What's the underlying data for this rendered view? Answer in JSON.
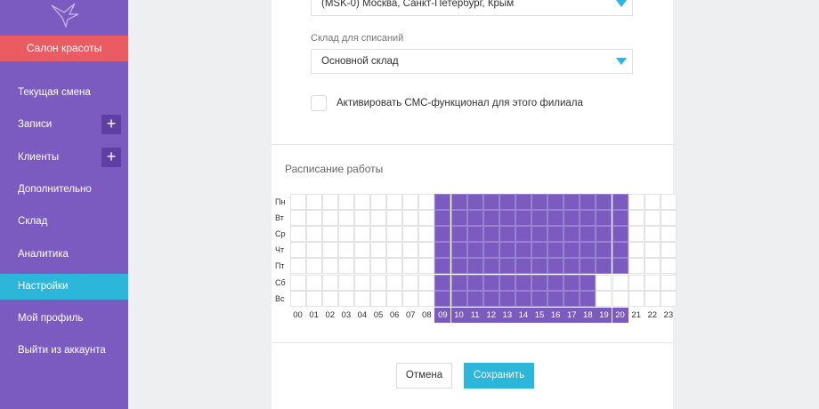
{
  "sidebar": {
    "salon_label": "Салон красоты",
    "items": [
      {
        "label": "Текущая смена",
        "active": false,
        "has_add": false
      },
      {
        "label": "Записи",
        "active": false,
        "has_add": true
      },
      {
        "label": "Клиенты",
        "active": false,
        "has_add": true
      },
      {
        "label": "Дополнительно",
        "active": false,
        "has_add": false
      },
      {
        "label": "Склад",
        "active": false,
        "has_add": false
      },
      {
        "label": "Аналитика",
        "active": false,
        "has_add": false
      },
      {
        "label": "Настройки",
        "active": true,
        "has_add": false
      },
      {
        "label": "Мой профиль",
        "active": false,
        "has_add": false
      },
      {
        "label": "Выйти из аккаунта",
        "active": false,
        "has_add": false
      }
    ],
    "add_symbol": "+"
  },
  "form": {
    "timezone_value": "(MSK-0) Москва, Санкт-Петербург, Крым",
    "warehouse_label": "Склад для списаний",
    "warehouse_value": "Основной склад",
    "sms_checkbox_label": "Активировать СМС-функционал для этого филиала",
    "sms_checked": false
  },
  "schedule": {
    "title": "Расписание работы",
    "days": [
      "Пн",
      "Вт",
      "Ср",
      "Чт",
      "Пт",
      "Сб",
      "Вс"
    ],
    "hours": [
      "00",
      "01",
      "02",
      "03",
      "04",
      "05",
      "06",
      "07",
      "08",
      "09",
      "10",
      "11",
      "12",
      "13",
      "14",
      "15",
      "16",
      "17",
      "18",
      "19",
      "20",
      "21",
      "22",
      "23"
    ],
    "active_hours": [
      [
        9,
        10,
        11,
        12,
        13,
        14,
        15,
        16,
        17,
        18,
        19,
        20
      ],
      [
        9,
        10,
        11,
        12,
        13,
        14,
        15,
        16,
        17,
        18,
        19,
        20
      ],
      [
        9,
        10,
        11,
        12,
        13,
        14,
        15,
        16,
        17,
        18,
        19,
        20
      ],
      [
        9,
        10,
        11,
        12,
        13,
        14,
        15,
        16,
        17,
        18,
        19,
        20
      ],
      [
        9,
        10,
        11,
        12,
        13,
        14,
        15,
        16,
        17,
        18,
        19,
        20
      ],
      [
        9,
        10,
        11,
        12,
        13,
        14,
        15,
        16,
        17,
        18
      ],
      [
        9,
        10,
        11,
        12,
        13,
        14,
        15,
        16,
        17,
        18
      ]
    ],
    "header_active_hours": [
      9,
      10,
      11,
      12,
      13,
      14,
      15,
      16,
      17,
      18,
      19,
      20
    ]
  },
  "actions": {
    "cancel_label": "Отмена",
    "save_label": "Сохранить"
  },
  "colors": {
    "sidebar_bg": "#7b5bbf",
    "salon_bg": "#ea5c62",
    "accent": "#2cb6da",
    "active_cell": "#7b5bbf"
  }
}
